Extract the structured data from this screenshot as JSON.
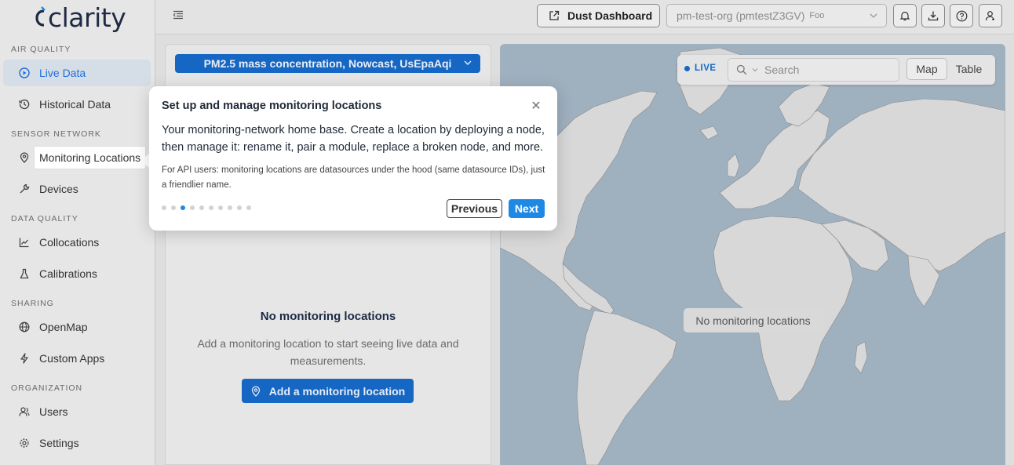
{
  "brand": {
    "name": "clarity"
  },
  "sidebar": {
    "sections": [
      {
        "label": "AIR QUALITY",
        "items": [
          {
            "label": "Live Data",
            "icon": "play-circle-icon",
            "active": true
          },
          {
            "label": "Historical Data",
            "icon": "history-icon"
          }
        ]
      },
      {
        "label": "SENSOR NETWORK",
        "items": [
          {
            "label": "Monitoring Locations",
            "icon": "location-pin-icon",
            "highlighted": true
          },
          {
            "label": "Devices",
            "icon": "wrench-icon"
          }
        ]
      },
      {
        "label": "DATA QUALITY",
        "items": [
          {
            "label": "Collocations",
            "icon": "line-chart-icon"
          },
          {
            "label": "Calibrations",
            "icon": "flask-icon"
          }
        ]
      },
      {
        "label": "SHARING",
        "items": [
          {
            "label": "OpenMap",
            "icon": "globe-icon"
          },
          {
            "label": "Custom Apps",
            "icon": "lightning-icon"
          }
        ]
      },
      {
        "label": "ORGANIZATION",
        "items": [
          {
            "label": "Users",
            "icon": "users-icon"
          },
          {
            "label": "Settings",
            "icon": "gear-icon"
          }
        ]
      }
    ]
  },
  "topbar": {
    "dust_button": "Dust Dashboard",
    "org_select": {
      "value": "pm-test-org (pmtestZ3GV)",
      "sub": "Foo"
    }
  },
  "panel": {
    "metric_select": "PM2.5 mass concentration, Nowcast, UsEpaAqi",
    "empty_title": "No monitoring locations",
    "empty_desc": "Add a monitoring location to start seeing live data and measurements.",
    "add_button": "Add a monitoring location"
  },
  "map": {
    "live_label": "LIVE",
    "search_placeholder": "Search",
    "view_toggle": {
      "map": "Map",
      "table": "Table"
    },
    "empty_label": "No monitoring locations"
  },
  "tour": {
    "title": "Set up and manage monitoring locations",
    "close": "✕",
    "body": "Your monitoring-network home base. Create a location by deploying a node, then manage it: rename it, pair a module, replace a broken node, and more.",
    "note": "For API users: monitoring locations are datasources under the hood (same datasource IDs), just a friendlier name.",
    "steps_total": 10,
    "step_current": 3,
    "previous": "Previous",
    "next": "Next"
  },
  "colors": {
    "accent": "#1e88e5",
    "primary": "#1667c3",
    "map_water": "#9fb0bf",
    "map_land": "#d8d8d8"
  }
}
